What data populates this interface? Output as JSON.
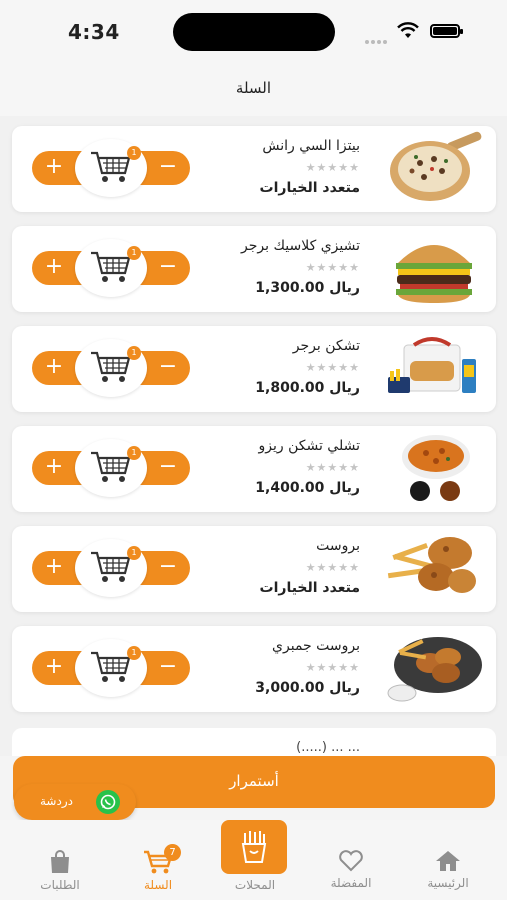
{
  "status_bar": {
    "time": "4:34"
  },
  "header": {
    "title": "السلة"
  },
  "products": [
    {
      "name": "بيتزا السي رانش",
      "stars": "★★★★★",
      "price": "متعدد الخيارات",
      "qty": "1",
      "image": "pizza-image"
    },
    {
      "name": "تشيزي كلاسيك برجر",
      "stars": "★★★★★",
      "price": "ريال 1,300.00",
      "qty": "1",
      "image": "burger-image"
    },
    {
      "name": "تشكن برجر",
      "stars": "★★★★★",
      "price": "ريال 1,800.00",
      "qty": "1",
      "image": "chicken-burger-meal-image"
    },
    {
      "name": "تشلي تشكن ريزو",
      "stars": "★★★★★",
      "price": "ريال 1,400.00",
      "qty": "1",
      "image": "chili-chicken-image"
    },
    {
      "name": "بروست",
      "stars": "★★★★★",
      "price": "متعدد الخيارات",
      "qty": "1",
      "image": "broast-image"
    },
    {
      "name": "بروست جمبري",
      "stars": "★★★★★",
      "price": "ريال 3,000.00",
      "qty": "1",
      "image": "shrimp-broast-image"
    }
  ],
  "stepper": {
    "plus": "+",
    "minus": "−"
  },
  "partial_item_text": "... ... (.....)",
  "continue_button": {
    "label": "أستمرار"
  },
  "chat": {
    "label": "دردشة"
  },
  "tab_bar": {
    "home": "الرئيسية",
    "favorites": "المفضلة",
    "stores": "المحلات",
    "cart": "السلة",
    "cart_badge": "7",
    "orders": "الطلبات"
  },
  "colors": {
    "accent": "#f08c1e",
    "whatsapp": "#28c24a"
  }
}
